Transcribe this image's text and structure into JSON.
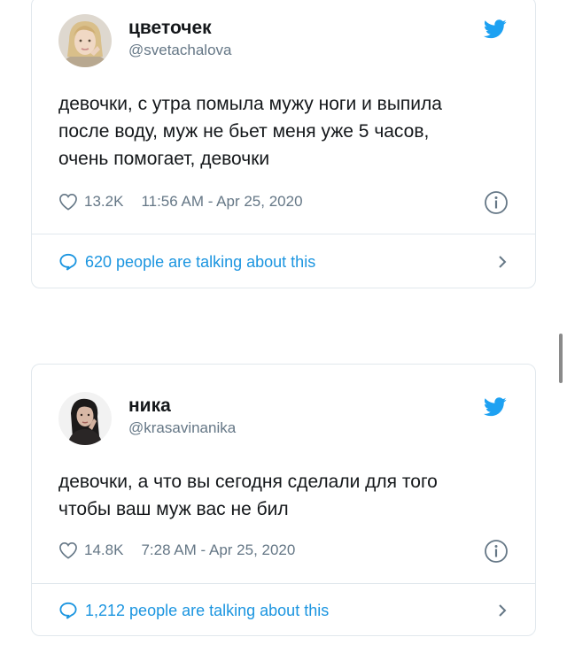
{
  "colors": {
    "twitter_blue": "#1da1f2",
    "link_blue": "#1b95e0",
    "text": "#14171a",
    "muted": "#657786",
    "border": "#e1e8ed"
  },
  "tweets": [
    {
      "name": "цветочек",
      "handle": "@svetachalova",
      "text_lines": [
        "девочки, с утра помыла мужу ноги и выпила",
        "после воду, муж не бьет меня уже 5 часов,",
        "очень помогает, девочки"
      ],
      "likes": "13.2K",
      "timestamp": "11:56 AM - Apr 25, 2020",
      "talking": "620 people are talking about this",
      "icons": [
        "avatar",
        "twitter-bird-icon",
        "heart-icon",
        "info-icon",
        "speech-bubble-icon",
        "chevron-right-icon"
      ]
    },
    {
      "name": "ника",
      "handle": "@krasavinanika",
      "text_lines": [
        "девочки, а что вы сегодня сделали для того",
        "чтобы ваш муж вас не бил"
      ],
      "likes": "14.8K",
      "timestamp": "7:28 AM - Apr 25, 2020",
      "talking": "1,212 people are talking about this",
      "icons": [
        "avatar",
        "twitter-bird-icon",
        "heart-icon",
        "info-icon",
        "speech-bubble-icon",
        "chevron-right-icon"
      ]
    }
  ]
}
